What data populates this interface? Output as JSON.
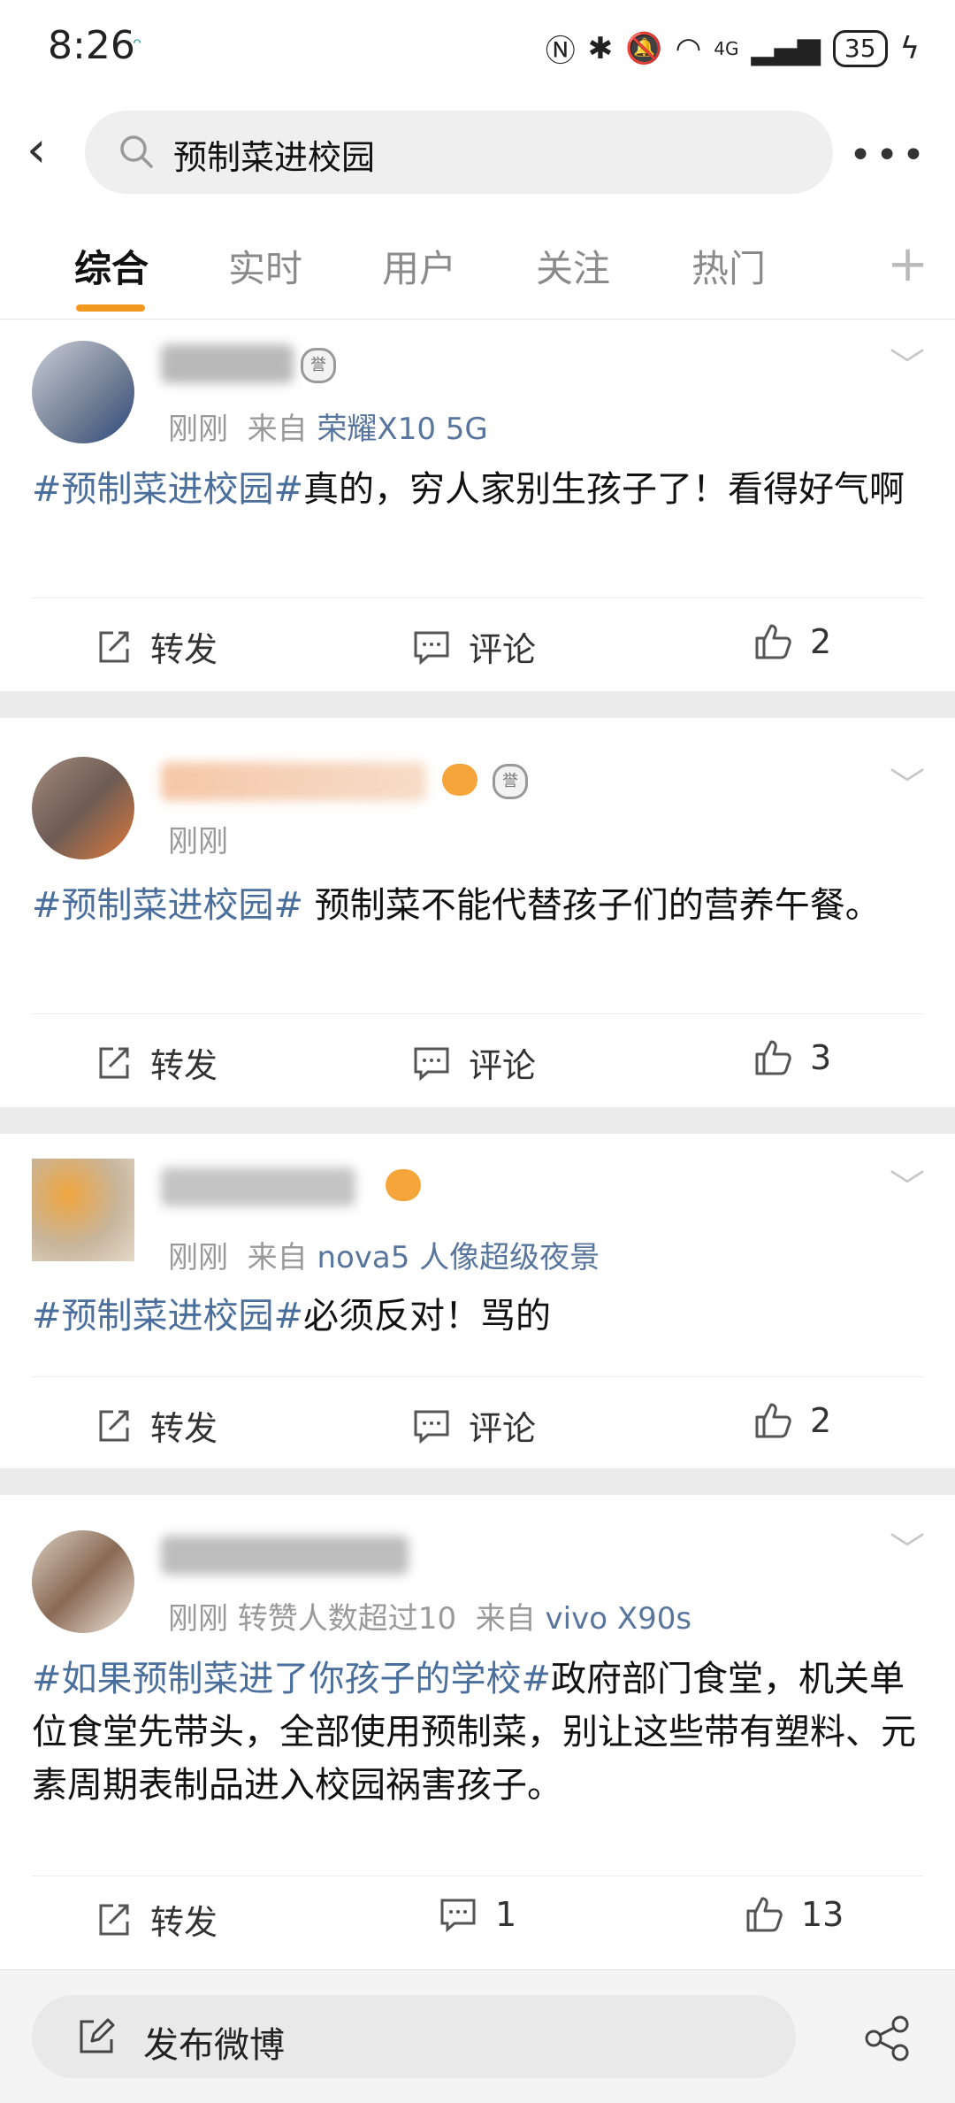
{
  "status_bar": {
    "time": "8:26",
    "network": "4G",
    "battery": "35"
  },
  "search": {
    "query": "预制菜进校园"
  },
  "tabs": [
    {
      "label": "综合",
      "active": true
    },
    {
      "label": "实时",
      "active": false
    },
    {
      "label": "用户",
      "active": false
    },
    {
      "label": "关注",
      "active": false
    },
    {
      "label": "热门",
      "active": false
    }
  ],
  "posts": [
    {
      "time": "刚刚",
      "from_prefix": "来自",
      "source": "荣耀X10 5G",
      "tag": "#预制菜进校园#",
      "text": "真的，穷人家别生孩子了！看得好气啊",
      "repost": "转发",
      "comment": "评论",
      "likes": "2"
    },
    {
      "time": "刚刚",
      "tag": "#预制菜进校园#",
      "text": " 预制菜不能代替孩子们的营养午餐。",
      "repost": "转发",
      "comment": "评论",
      "likes": "3"
    },
    {
      "time": "刚刚",
      "from_prefix": "来自",
      "source": "nova5 人像超级夜景",
      "tag": "#预制菜进校园#",
      "text": "必须反对！骂的",
      "repost": "转发",
      "comment": "评论",
      "likes": "2"
    },
    {
      "time": "刚刚",
      "extra": "转赞人数超过10",
      "from_prefix": "来自",
      "source": "vivo X90s",
      "tag": "#如果预制菜进了你孩子的学校#",
      "text": "政府部门食堂，机关单位食堂先带头，全部使用预制菜，别让这些带有塑料、元素周期表制品进入校园祸害孩子。",
      "repost": "转发",
      "comment": "1",
      "likes": "13"
    }
  ],
  "bottom": {
    "compose_label": "发布微博"
  },
  "badge_char": "誉",
  "colors": {
    "accent": "#f29a1f",
    "link": "#4b6f9d"
  }
}
